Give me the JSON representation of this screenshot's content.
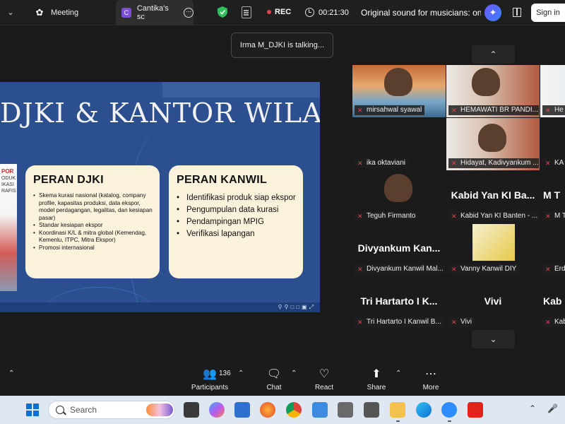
{
  "topbar": {
    "meeting_tab": "Meeting",
    "share_tab": "Cantika's sc",
    "share_tab_badge": "C",
    "rec_label": "REC",
    "timer": "00:21:30",
    "original_sound": "Original sound for musicians: on",
    "sign_in": "Sign in"
  },
  "talking": "Irma M_DJKI is talking...",
  "slide": {
    "title": "DJKI & KANTOR WILAYAH",
    "poster_lines": "ODUK\nIKASI\nRAFIS",
    "poster_red": "POR",
    "card1_title": "PERAN DJKI",
    "card1_items": [
      "Skema kurasi nasional (katalog, company profile, kapasitas produksi, data ekspor, model perdagangan, legalitas, dan kesiapan pasar)",
      "Standar kesiapan ekspor",
      "Koordinasi K/L & mitra global (Kemendag, Kemenlu, ITPC, Mitra Ekspor)",
      "Promosi internasional"
    ],
    "card2_title": "PERAN KANWIL",
    "card2_items": [
      "Identifikasi produk siap ekspor",
      "Pengumpulan data kurasi",
      "Pendampingan MPIG",
      "Verifikasi lapangan"
    ]
  },
  "gallery": {
    "tiles": [
      {
        "name": "mirsahwal syawal",
        "big": ""
      },
      {
        "name": "HEMAWATI BR PANDI...",
        "big": ""
      },
      {
        "name": "He",
        "big": ""
      },
      {
        "name": "ika oktaviani",
        "big": ""
      },
      {
        "name": "Hidayat, Kadivyankum ...",
        "big": ""
      },
      {
        "name": "KA",
        "big": ""
      },
      {
        "name": "Teguh Firmanto",
        "big": ""
      },
      {
        "name": "Kabid Yan KI Banten - ...",
        "big": "Kabid Yan KI Ba..."
      },
      {
        "name": "M T",
        "big": "M T"
      },
      {
        "name": "Divyankum Kanwil Mal...",
        "big": "Divyankum Kan..."
      },
      {
        "name": "Vanny Kanwil DIY",
        "big": ""
      },
      {
        "name": "Erd",
        "big": ""
      },
      {
        "name": "Tri Hartarto I Kanwil B...",
        "big": "Tri Hartarto I K..."
      },
      {
        "name": "Vivi",
        "big": "Vivi"
      },
      {
        "name": "Kab",
        "big": "Kab"
      }
    ]
  },
  "toolbar": {
    "participants_label": "Participants",
    "participants_count": "136",
    "chat_label": "Chat",
    "react_label": "React",
    "share_label": "Share",
    "more_label": "More"
  },
  "taskbar": {
    "search_placeholder": "Search"
  }
}
